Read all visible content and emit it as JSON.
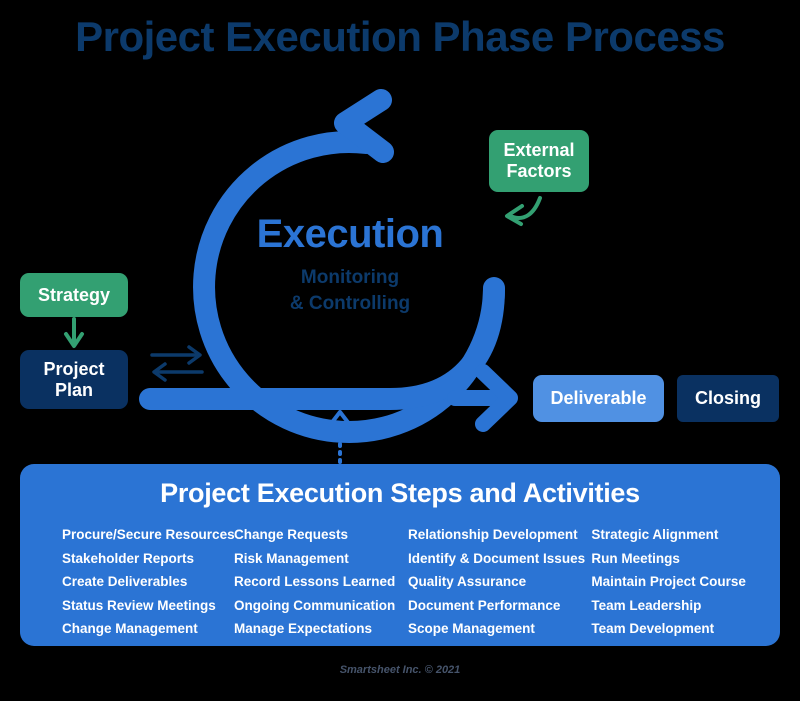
{
  "title": "Project Execution Phase Process",
  "center": {
    "heading": "Execution",
    "subheading_line1": "Monitoring",
    "subheading_line2": "& Controlling"
  },
  "nodes": {
    "external_factors": "External\nFactors",
    "external_factors_line1": "External",
    "external_factors_line2": "Factors",
    "strategy": "Strategy",
    "project_plan_line1": "Project",
    "project_plan_line2": "Plan",
    "deliverable": "Deliverable",
    "closing": "Closing"
  },
  "panel": {
    "title": "Project Execution Steps and Activities",
    "columns": [
      {
        "items": [
          "Procure/Secure Resources",
          "Stakeholder Reports",
          "Create Deliverables",
          "Status Review Meetings",
          "Change Management"
        ]
      },
      {
        "items": [
          "Change Requests",
          "Risk Management",
          "Record Lessons Learned",
          "Ongoing Communication",
          "Manage Expectations"
        ]
      },
      {
        "items": [
          "Relationship Development",
          "Identify & Document Issues",
          "Quality Assurance",
          "Document Performance",
          "Scope Management"
        ]
      },
      {
        "items": [
          "Strategic Alignment",
          "Run Meetings",
          "Maintain Project Course",
          "Team Leadership",
          "Team Development"
        ]
      }
    ]
  },
  "footer": "Smartsheet Inc. © 2021",
  "colors": {
    "background": "#000000",
    "title": "#0C3A6B",
    "accent_blue": "#2B74D4",
    "light_blue": "#5091E3",
    "navy": "#0A3161",
    "green": "#33A072",
    "white": "#FFFFFF",
    "footer_gray": "#46546B"
  },
  "icons": {
    "cycle_arrow": "circular-process-arrow",
    "external_factors_arrow": "curved-arrow-down-left",
    "strategy_arrow": "arrow-down",
    "exchange_arrow": "bidirectional-exchange-arrow",
    "deliverable_arrow": "arrow-right",
    "panel_arrow": "dotted-arrow-up"
  }
}
